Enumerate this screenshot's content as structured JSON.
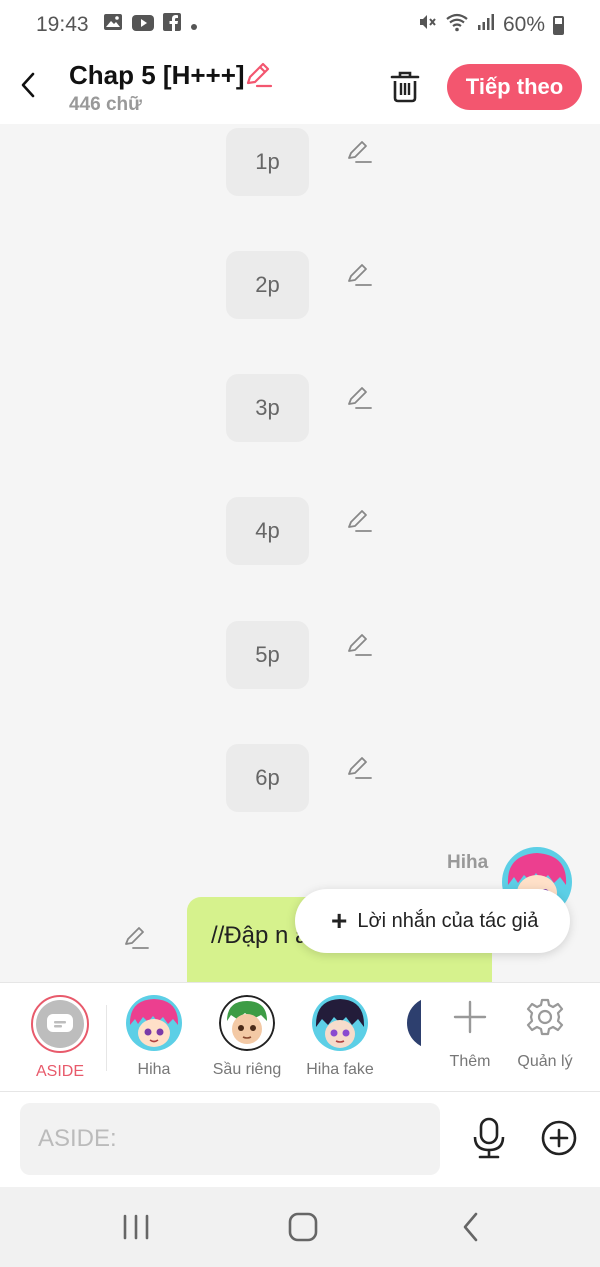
{
  "status_bar": {
    "time": "19:43",
    "battery": "60%",
    "icons": [
      "gallery-icon",
      "youtube-icon",
      "facebook-icon",
      "dot-icon",
      "mute-icon",
      "wifi-icon",
      "signal-icon",
      "battery-icon"
    ]
  },
  "header": {
    "title": "Chap 5 [H+++]",
    "word_count": "446 chữ",
    "next_label": "Tiếp theo",
    "accent_color": "#f3566f"
  },
  "chat": {
    "pauses": [
      "1p",
      "2p",
      "3p",
      "4p",
      "5p",
      "6p"
    ],
    "speaker": "Hiha",
    "message": "//Đập n anh//",
    "popup_label": "Lời nhắn của tác giả",
    "bubble_color": "#d6f28d"
  },
  "characters": [
    {
      "name": "ASIDE"
    },
    {
      "name": "Hiha"
    },
    {
      "name": "Sầu riêng"
    },
    {
      "name": "Hiha fake"
    }
  ],
  "tools": {
    "add_label": "Thêm",
    "manage_label": "Quản lý"
  },
  "input": {
    "placeholder": "ASIDE:"
  }
}
